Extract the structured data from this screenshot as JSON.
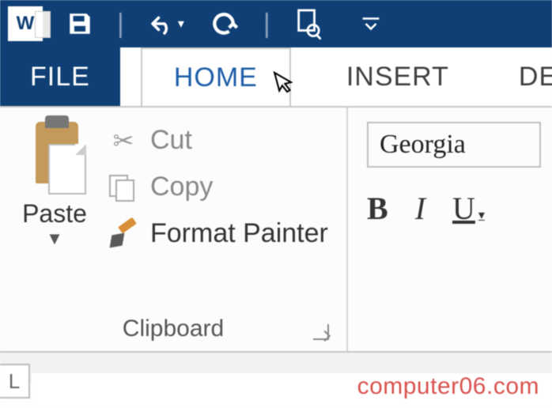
{
  "titlebar": {
    "app_letter": "W"
  },
  "tabs": {
    "file": "FILE",
    "home": "HOME",
    "insert": "INSERT",
    "design": "DES"
  },
  "ribbon": {
    "clipboard": {
      "paste": "Paste",
      "cut": "Cut",
      "copy": "Copy",
      "format_painter": "Format Painter",
      "group_label": "Clipboard"
    },
    "font": {
      "font_name": "Georgia",
      "bold": "B",
      "italic": "I",
      "underline": "U"
    }
  },
  "corner": "L",
  "watermark": "computer06.com"
}
